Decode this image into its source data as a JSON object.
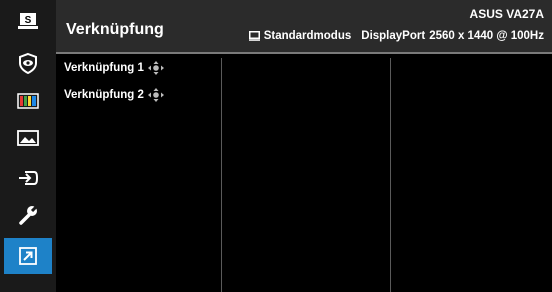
{
  "header": {
    "title": "Verknüpfung",
    "model": "ASUS  VA27A",
    "mode": "Standardmodus",
    "input": "DisplayPort",
    "resolution": "2560 x 1440 @ 100Hz"
  },
  "sidebar": {
    "items": [
      {
        "icon": "splendid-icon",
        "label": "S"
      },
      {
        "icon": "eye-care-icon"
      },
      {
        "icon": "color-icon"
      },
      {
        "icon": "image-icon"
      },
      {
        "icon": "input-select-icon"
      },
      {
        "icon": "system-setup-icon"
      },
      {
        "icon": "shortcut-icon",
        "active": true
      }
    ]
  },
  "menu": {
    "items": [
      {
        "label": "Verknüpfung 1"
      },
      {
        "label": "Verknüpfung 2"
      }
    ]
  },
  "colors": {
    "active": "#1e82c8",
    "header_bg": "#2b2b2b",
    "sidebar_bg": "#1a1a1a"
  }
}
